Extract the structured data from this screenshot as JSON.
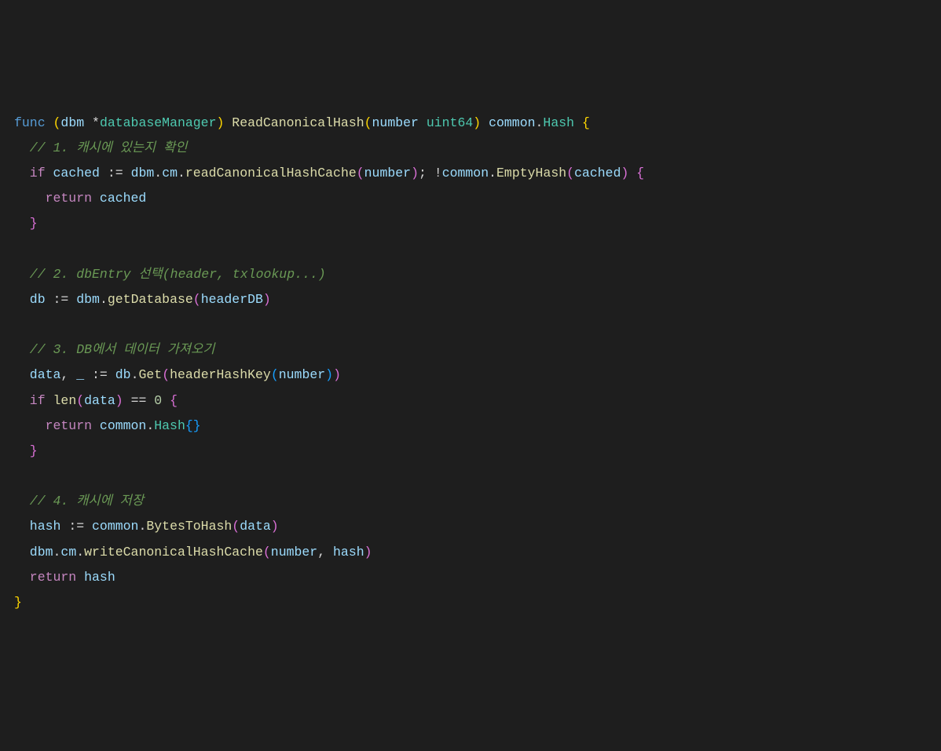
{
  "code": {
    "line1": {
      "func": "func",
      "dbm": "dbm",
      "star": "*",
      "databaseManager": "databaseManager",
      "ReadCanonicalHash": "ReadCanonicalHash",
      "number": "number",
      "uint64": "uint64",
      "common": "common",
      "Hash": "Hash"
    },
    "line2": {
      "comment": "// 1. 캐시에 있는지 확인"
    },
    "line3": {
      "if": "if",
      "cached": "cached",
      "assign": ":=",
      "dbm": "dbm",
      "cm": "cm",
      "readCanonicalHashCache": "readCanonicalHashCache",
      "number": "number",
      "bang": "!",
      "common": "common",
      "EmptyHash": "EmptyHash",
      "cached2": "cached"
    },
    "line4": {
      "return": "return",
      "cached": "cached"
    },
    "line6": {
      "comment": "// 2. dbEntry 선택(header, txlookup...)"
    },
    "line7": {
      "db": "db",
      "assign": ":=",
      "dbm": "dbm",
      "getDatabase": "getDatabase",
      "headerDB": "headerDB"
    },
    "line9": {
      "comment": "// 3. DB에서 데이터 가져오기"
    },
    "line10": {
      "data": "data",
      "underscore": "_",
      "assign": ":=",
      "db": "db",
      "Get": "Get",
      "headerHashKey": "headerHashKey",
      "number": "number"
    },
    "line11": {
      "if": "if",
      "len": "len",
      "data": "data",
      "eq": "==",
      "zero": "0"
    },
    "line12": {
      "return": "return",
      "common": "common",
      "Hash": "Hash"
    },
    "line15": {
      "comment": "// 4. 캐시에 저장"
    },
    "line16": {
      "hash": "hash",
      "assign": ":=",
      "common": "common",
      "BytesToHash": "BytesToHash",
      "data": "data"
    },
    "line17": {
      "dbm": "dbm",
      "cm": "cm",
      "writeCanonicalHashCache": "writeCanonicalHashCache",
      "number": "number",
      "hash": "hash"
    },
    "line18": {
      "return": "return",
      "hash": "hash"
    }
  }
}
